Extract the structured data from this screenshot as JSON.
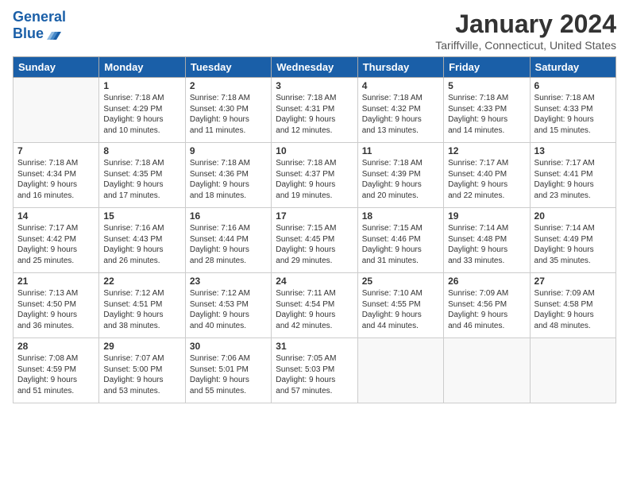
{
  "header": {
    "logo_line1": "General",
    "logo_line2": "Blue",
    "month": "January 2024",
    "location": "Tariffville, Connecticut, United States"
  },
  "weekdays": [
    "Sunday",
    "Monday",
    "Tuesday",
    "Wednesday",
    "Thursday",
    "Friday",
    "Saturday"
  ],
  "weeks": [
    [
      {
        "day": "",
        "text": ""
      },
      {
        "day": "1",
        "text": "Sunrise: 7:18 AM\nSunset: 4:29 PM\nDaylight: 9 hours\nand 10 minutes."
      },
      {
        "day": "2",
        "text": "Sunrise: 7:18 AM\nSunset: 4:30 PM\nDaylight: 9 hours\nand 11 minutes."
      },
      {
        "day": "3",
        "text": "Sunrise: 7:18 AM\nSunset: 4:31 PM\nDaylight: 9 hours\nand 12 minutes."
      },
      {
        "day": "4",
        "text": "Sunrise: 7:18 AM\nSunset: 4:32 PM\nDaylight: 9 hours\nand 13 minutes."
      },
      {
        "day": "5",
        "text": "Sunrise: 7:18 AM\nSunset: 4:33 PM\nDaylight: 9 hours\nand 14 minutes."
      },
      {
        "day": "6",
        "text": "Sunrise: 7:18 AM\nSunset: 4:33 PM\nDaylight: 9 hours\nand 15 minutes."
      }
    ],
    [
      {
        "day": "7",
        "text": "Sunrise: 7:18 AM\nSunset: 4:34 PM\nDaylight: 9 hours\nand 16 minutes."
      },
      {
        "day": "8",
        "text": "Sunrise: 7:18 AM\nSunset: 4:35 PM\nDaylight: 9 hours\nand 17 minutes."
      },
      {
        "day": "9",
        "text": "Sunrise: 7:18 AM\nSunset: 4:36 PM\nDaylight: 9 hours\nand 18 minutes."
      },
      {
        "day": "10",
        "text": "Sunrise: 7:18 AM\nSunset: 4:37 PM\nDaylight: 9 hours\nand 19 minutes."
      },
      {
        "day": "11",
        "text": "Sunrise: 7:18 AM\nSunset: 4:39 PM\nDaylight: 9 hours\nand 20 minutes."
      },
      {
        "day": "12",
        "text": "Sunrise: 7:17 AM\nSunset: 4:40 PM\nDaylight: 9 hours\nand 22 minutes."
      },
      {
        "day": "13",
        "text": "Sunrise: 7:17 AM\nSunset: 4:41 PM\nDaylight: 9 hours\nand 23 minutes."
      }
    ],
    [
      {
        "day": "14",
        "text": "Sunrise: 7:17 AM\nSunset: 4:42 PM\nDaylight: 9 hours\nand 25 minutes."
      },
      {
        "day": "15",
        "text": "Sunrise: 7:16 AM\nSunset: 4:43 PM\nDaylight: 9 hours\nand 26 minutes."
      },
      {
        "day": "16",
        "text": "Sunrise: 7:16 AM\nSunset: 4:44 PM\nDaylight: 9 hours\nand 28 minutes."
      },
      {
        "day": "17",
        "text": "Sunrise: 7:15 AM\nSunset: 4:45 PM\nDaylight: 9 hours\nand 29 minutes."
      },
      {
        "day": "18",
        "text": "Sunrise: 7:15 AM\nSunset: 4:46 PM\nDaylight: 9 hours\nand 31 minutes."
      },
      {
        "day": "19",
        "text": "Sunrise: 7:14 AM\nSunset: 4:48 PM\nDaylight: 9 hours\nand 33 minutes."
      },
      {
        "day": "20",
        "text": "Sunrise: 7:14 AM\nSunset: 4:49 PM\nDaylight: 9 hours\nand 35 minutes."
      }
    ],
    [
      {
        "day": "21",
        "text": "Sunrise: 7:13 AM\nSunset: 4:50 PM\nDaylight: 9 hours\nand 36 minutes."
      },
      {
        "day": "22",
        "text": "Sunrise: 7:12 AM\nSunset: 4:51 PM\nDaylight: 9 hours\nand 38 minutes."
      },
      {
        "day": "23",
        "text": "Sunrise: 7:12 AM\nSunset: 4:53 PM\nDaylight: 9 hours\nand 40 minutes."
      },
      {
        "day": "24",
        "text": "Sunrise: 7:11 AM\nSunset: 4:54 PM\nDaylight: 9 hours\nand 42 minutes."
      },
      {
        "day": "25",
        "text": "Sunrise: 7:10 AM\nSunset: 4:55 PM\nDaylight: 9 hours\nand 44 minutes."
      },
      {
        "day": "26",
        "text": "Sunrise: 7:09 AM\nSunset: 4:56 PM\nDaylight: 9 hours\nand 46 minutes."
      },
      {
        "day": "27",
        "text": "Sunrise: 7:09 AM\nSunset: 4:58 PM\nDaylight: 9 hours\nand 48 minutes."
      }
    ],
    [
      {
        "day": "28",
        "text": "Sunrise: 7:08 AM\nSunset: 4:59 PM\nDaylight: 9 hours\nand 51 minutes."
      },
      {
        "day": "29",
        "text": "Sunrise: 7:07 AM\nSunset: 5:00 PM\nDaylight: 9 hours\nand 53 minutes."
      },
      {
        "day": "30",
        "text": "Sunrise: 7:06 AM\nSunset: 5:01 PM\nDaylight: 9 hours\nand 55 minutes."
      },
      {
        "day": "31",
        "text": "Sunrise: 7:05 AM\nSunset: 5:03 PM\nDaylight: 9 hours\nand 57 minutes."
      },
      {
        "day": "",
        "text": ""
      },
      {
        "day": "",
        "text": ""
      },
      {
        "day": "",
        "text": ""
      }
    ]
  ]
}
